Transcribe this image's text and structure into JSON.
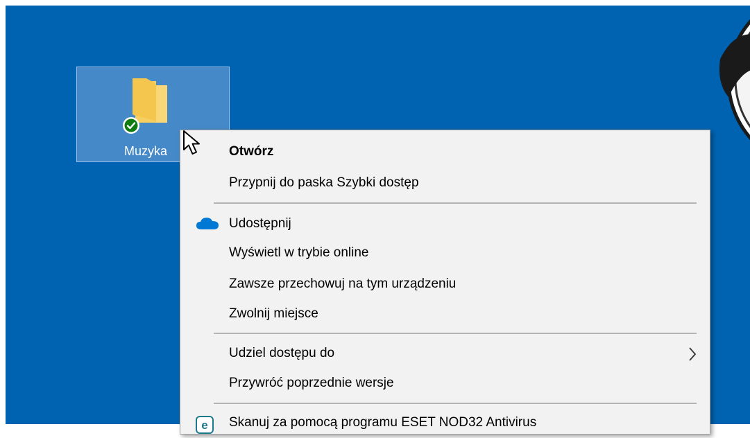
{
  "desktop": {
    "background_color": "#0063b1",
    "icon": {
      "label": "Muzyka",
      "icon": "folder-icon",
      "status_icon": "sync-check-icon",
      "selected": true
    }
  },
  "context_menu": {
    "items": [
      {
        "label": "Otwórz",
        "bold": true
      },
      {
        "label": "Przypnij do paska Szybki dostęp"
      },
      {
        "label": "Udostępnij",
        "icon": "onedrive-cloud-icon"
      },
      {
        "label": "Wyświetl w trybie online"
      },
      {
        "label": "Zawsze przechowuj na tym urządzeniu"
      },
      {
        "label": "Zwolnij miejsce"
      },
      {
        "label": "Udziel dostępu do",
        "submenu": true
      },
      {
        "label": "Przywróć poprzednie wersje"
      },
      {
        "label": "Skanuj za pomocą programu ESET NOD32 Antivirus",
        "icon": "eset-icon"
      }
    ]
  },
  "colors": {
    "menu_background": "#f2f2f2",
    "onedrive_blue": "#0078d4",
    "sync_green": "#107c10",
    "folder_yellow": "#f4c64e"
  }
}
